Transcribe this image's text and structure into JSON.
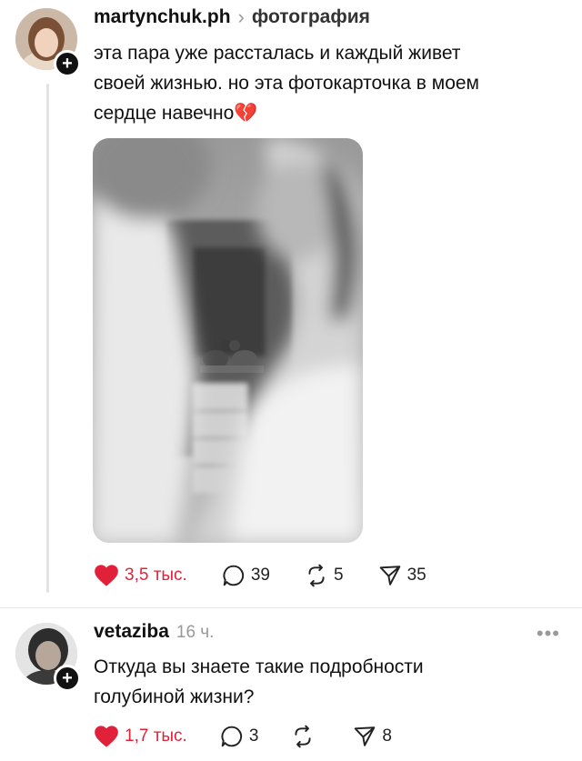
{
  "post": {
    "username": "martynchuk.ph",
    "separator": "›",
    "topic": "фотография",
    "text_lines": [
      "эта пара уже рассталась и каждый живет",
      "своей жизнью. но эта фотокарточка в моем",
      "сердце навечно"
    ],
    "emoji": "💔",
    "stats": {
      "likes": "3,5 тыс.",
      "comments": "39",
      "reposts": "5",
      "shares": "35"
    }
  },
  "reply": {
    "username": "vetaziba",
    "time": "16 ч.",
    "text_lines": [
      "Откуда вы знаете такие подробности",
      "голубиной жизни?"
    ],
    "stats": {
      "likes": "1,7 тыс.",
      "comments": "3",
      "reposts": "",
      "shares": "8"
    },
    "more_label": "•••"
  },
  "icons": {
    "follow": "plus-icon",
    "like": "heart-icon",
    "comment": "comment-icon",
    "repost": "repost-icon",
    "share": "send-icon"
  },
  "colors": {
    "like_red": "#e1213a",
    "text": "#111111",
    "muted": "#999999"
  }
}
